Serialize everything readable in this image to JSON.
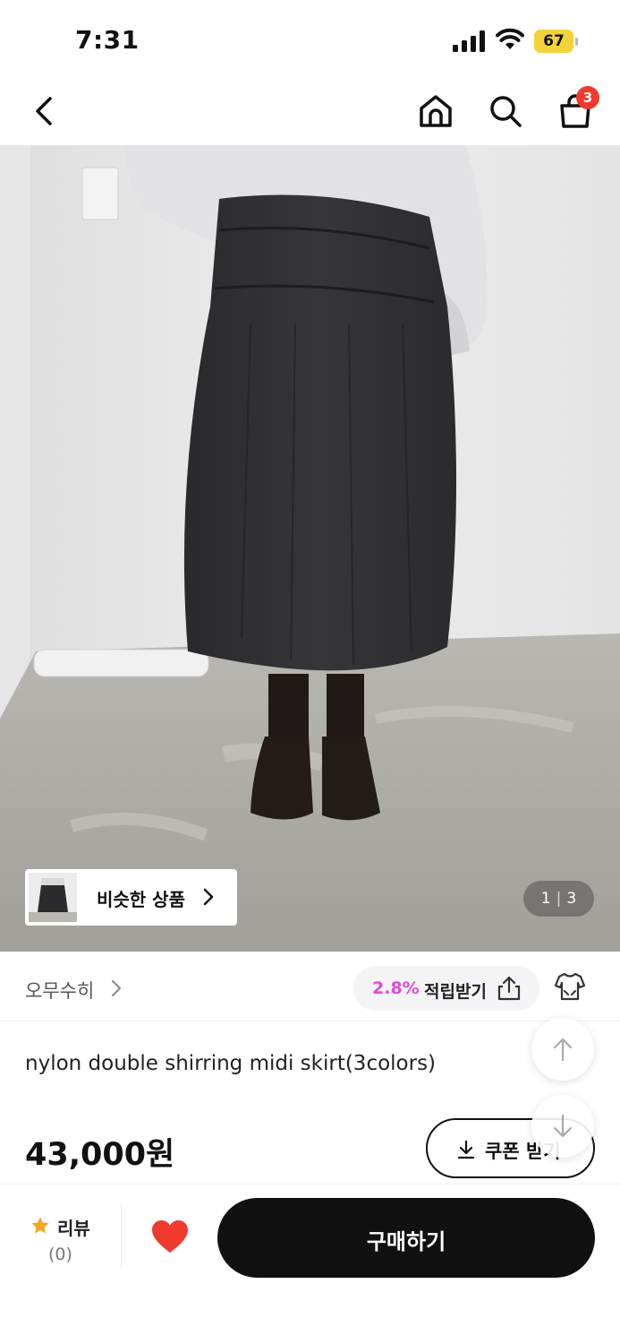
{
  "status_bar": {
    "time": "7:31",
    "battery_level": "67",
    "battery_color": "#f2d43a"
  },
  "nav": {
    "back_icon": "chevron-left-icon",
    "home_icon": "home-icon",
    "search_icon": "search-icon",
    "bag_icon": "shopping-bag-icon",
    "cart_count": "3",
    "badge_color": "#f03a2e"
  },
  "gallery": {
    "similar_label": "비슷한 상품",
    "current_page": "1",
    "separator": "|",
    "total_pages": "3"
  },
  "brand": {
    "name": "오무수히",
    "points_rate": "2.8%",
    "points_label": "적립받기",
    "points_color": "#e04ad9",
    "share_icon": "share-icon",
    "outfit_icon": "outfit-icon"
  },
  "product": {
    "title": "nylon double shirring midi skirt(3colors)",
    "price": "43,000원"
  },
  "coupon": {
    "label": "쿠폰 받기",
    "icon": "download-icon"
  },
  "scroll": {
    "up_icon": "arrow-up-icon",
    "down_icon": "arrow-down-icon"
  },
  "bottom_bar": {
    "review_label": "리뷰",
    "review_count": "(0)",
    "star_color": "#f5a623",
    "heart_color": "#f03a2e",
    "buy_label": "구매하기"
  }
}
